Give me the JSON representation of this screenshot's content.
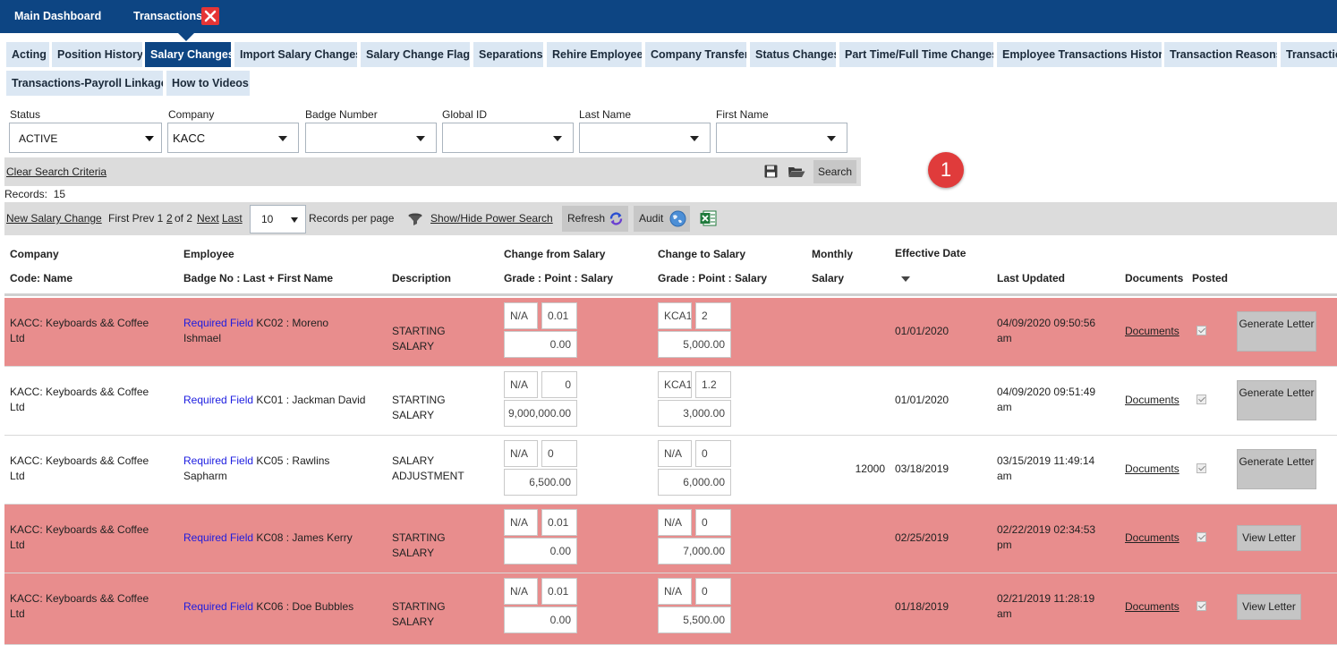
{
  "topbar": {
    "main_tab": "Main Dashboard",
    "transactions_tab": "Transactions"
  },
  "subtabs": [
    "Acting",
    "Position History",
    "Salary Changes",
    "Import Salary Changes",
    "Salary Change Flags",
    "Separations",
    "Rehire Employee",
    "Company Transfer",
    "Status Changes",
    "Part Time/Full Time Changes",
    "Employee Transactions History",
    "Transaction Reasons",
    "Transactio",
    "Transactions-Payroll Linkages",
    "How to Videos"
  ],
  "active_subtab": "Salary Changes",
  "filters": {
    "status": {
      "label": "Status",
      "value": "ACTIVE"
    },
    "company": {
      "label": "Company",
      "value": "KACC"
    },
    "badge": {
      "label": "Badge Number",
      "value": ""
    },
    "global": {
      "label": "Global ID",
      "value": ""
    },
    "last": {
      "label": "Last Name",
      "value": ""
    },
    "first": {
      "label": "First Name",
      "value": ""
    }
  },
  "search": {
    "clear_label": "Clear Search Criteria",
    "search_label": "Search"
  },
  "callout": "1",
  "records": {
    "label": "Records:",
    "count": "15"
  },
  "pager": {
    "new_label": "New Salary Change",
    "first_prev": "First Prev 1",
    "page2": "2",
    "of_text": "of 2",
    "next": "Next",
    "last": "Last",
    "per_page_value": "10",
    "per_page_label": "Records per page",
    "power_search": "Show/Hide Power Search",
    "refresh": "Refresh",
    "audit": "Audit"
  },
  "headers": {
    "company1": "Company",
    "company2": "Code: Name",
    "employee1": "Employee",
    "employee2": "Badge No : Last + First Name",
    "description": "Description",
    "from1": "Change from Salary",
    "from2": "Grade : Point : Salary",
    "to1": "Change to Salary",
    "to2": "Grade : Point : Salary",
    "monthly1": "Monthly",
    "monthly2": "Salary",
    "effective": "Effective Date",
    "updated": "Last Updated",
    "documents": "Documents",
    "posted": "Posted"
  },
  "rows": [
    {
      "company": "KACC: Keyboards && Coffee Ltd",
      "req": "Required Field",
      "emp": "KC02 : Moreno Ishmael",
      "desc": "STARTING SALARY",
      "from_grade": "N/A",
      "from_point": "0.01",
      "from_salary": "0.00",
      "to_grade": "KCA1",
      "to_point": "2",
      "to_salary": "5,000.00",
      "monthly": "",
      "effective": "01/01/2020",
      "updated": "04/09/2020 09:50:56 am",
      "documents": "Documents",
      "action": "Generate Letter",
      "highlight": true
    },
    {
      "company": "KACC: Keyboards && Coffee Ltd",
      "req": "Required Field",
      "emp": "KC01 : Jackman David",
      "desc": "STARTING SALARY",
      "from_grade": "N/A",
      "from_point": "0",
      "from_salary": "9,000,000.00",
      "to_grade": "KCA1",
      "to_point": "1.2",
      "to_salary": "3,000.00",
      "monthly": "",
      "effective": "01/01/2020",
      "updated": "04/09/2020 09:51:49 am",
      "documents": "Documents",
      "action": "Generate Letter",
      "highlight": false
    },
    {
      "company": "KACC: Keyboards && Coffee Ltd",
      "req": "Required Field",
      "emp": "KC05 : Rawlins Sapharm",
      "desc": "SALARY ADJUSTMENT",
      "from_grade": "N/A",
      "from_point": "0",
      "from_salary": "6,500.00",
      "to_grade": "N/A",
      "to_point": "0",
      "to_salary": "6,000.00",
      "monthly": "12000",
      "effective": "03/18/2019",
      "updated": "03/15/2019 11:49:14 am",
      "documents": "Documents",
      "action": "Generate Letter",
      "highlight": false
    },
    {
      "company": "KACC: Keyboards && Coffee Ltd",
      "req": "Required Field",
      "emp": "KC08 : James Kerry",
      "desc": "STARTING SALARY",
      "from_grade": "N/A",
      "from_point": "0.01",
      "from_salary": "0.00",
      "to_grade": "N/A",
      "to_point": "0",
      "to_salary": "7,000.00",
      "monthly": "",
      "effective": "02/25/2019",
      "updated": "02/22/2019 02:34:53 pm",
      "documents": "Documents",
      "action": "View Letter",
      "highlight": true
    },
    {
      "company": "KACC: Keyboards && Coffee Ltd",
      "req": "Required Field",
      "emp": "KC06 : Doe Bubbles",
      "desc": "STARTING SALARY",
      "from_grade": "N/A",
      "from_point": "0.01",
      "from_salary": "0.00",
      "to_grade": "N/A",
      "to_point": "0",
      "to_salary": "5,500.00",
      "monthly": "",
      "effective": "01/18/2019",
      "updated": "02/21/2019 11:28:19 am",
      "documents": "Documents",
      "action": "View Letter",
      "highlight": true
    }
  ],
  "colors": {
    "navy": "#0d4583",
    "highlight_row": "#e88d8d",
    "tab_bg": "#dbe7f3",
    "link_blue": "#1c1ce0",
    "callout_red": "#e03b3b"
  }
}
